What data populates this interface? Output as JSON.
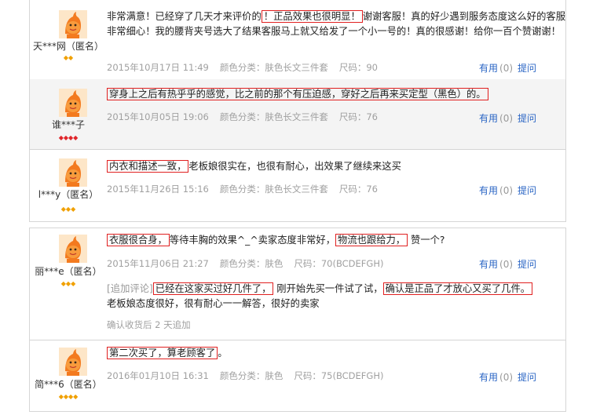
{
  "reviews": [
    {
      "user": "天***网（匿名）",
      "gems": "◆◆",
      "text_pre": "非常满意！已经穿了几天才来评价的",
      "hl1": "！正品效果也很明显！",
      "text_post": "谢谢客服！真的好少遇到服务态度这么好的客服非常细心！我的腰背夹号选大了结果客服马上就又给发了一个小一号的！真的很感谢！给你一百个赞谢谢！",
      "date": "2015年10月17日 11:49",
      "color": "颜色分类：肤色长文三件套",
      "size": "尺码：90",
      "useful": "有用",
      "count": "(0)",
      "ask": "提问"
    },
    {
      "user": "谁***子",
      "gems": "◆◆◆◆",
      "hl1": "穿身上之后有热乎乎的感觉，比之前的那个有压迫感，穿好之后再来买定型（黑色）的。",
      "date": "2015年10月05日 19:06",
      "color": "颜色分类：肤色长文三件套",
      "size": "尺码：76",
      "useful": "有用",
      "count": "(0)",
      "ask": "提问"
    },
    {
      "user": "l***y（匿名）",
      "gems": "◆◆◆",
      "hl1": "内衣和描述一致，",
      "text_post": "老板娘很实在，也很有耐心，出效果了继续来这买",
      "date": "2015年11月26日 15:16",
      "color": "颜色分类：肤色长文三件套",
      "size": "尺码：76",
      "useful": "有用",
      "count": "(0)",
      "ask": "提问"
    },
    {
      "user": "丽***e（匿名）",
      "gems": "◆◆◆",
      "hl1": "衣服很合身，",
      "text_mid": "等待丰胸的效果^_^卖家态度非常好，",
      "hl2": "物流也跟给力，",
      "text_post": "赞一个?",
      "date": "2015年11月06日 21:27",
      "color": "颜色分类：肤色",
      "size": "尺码：70(BCDEFGH)",
      "add_tag": "[追加评论]",
      "add_hl1": "已经在这家买过好几件了，",
      "add_mid": "刚开始先买一件试了试，",
      "add_hl2": "确认是正品了才放心又买了几件。",
      "add_line2": "老板娘态度很好，很有耐心一一解答，很好的卖家",
      "add_time": "确认收货后 2 天追加",
      "useful": "有用",
      "count": "(0)",
      "ask": "提问"
    },
    {
      "user": "简***6（匿名）",
      "gems": "◆◆◆◆",
      "hl1": "第二次买了，算老顾客了",
      "text_post": "。",
      "date": "2016年01月10日 16:31",
      "color": "颜色分类：肤色",
      "size": "尺码：75(BCDEFGH)",
      "useful": "有用",
      "count": "(0)",
      "ask": "提问"
    }
  ]
}
